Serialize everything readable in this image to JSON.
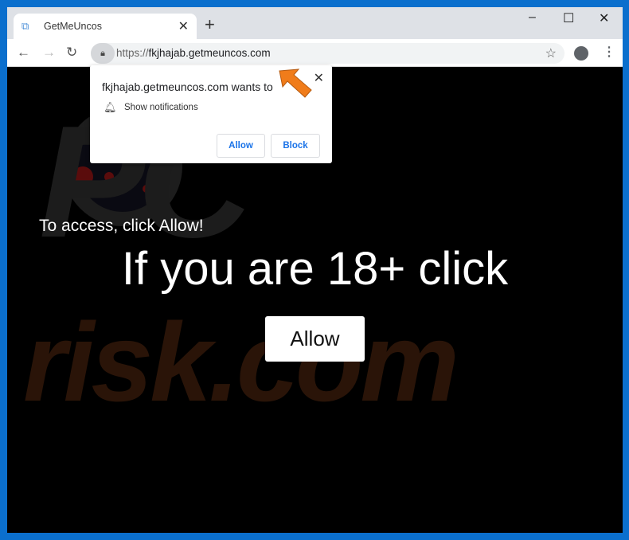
{
  "browser": {
    "tab": {
      "title": "GetMeUncos",
      "favicon": "site-icon"
    },
    "url": {
      "scheme": "https://",
      "host": "fkjhajab.getmeuncos.com"
    },
    "window_controls": {
      "minimize": "–",
      "maximize": "☐",
      "close": "✕"
    }
  },
  "popup": {
    "heading": "fkjhajab.getmeuncos.com wants to",
    "permission": "Show notifications",
    "allow_label": "Allow",
    "block_label": "Block",
    "close": "✕"
  },
  "page": {
    "instruction": "To access, click Allow!",
    "headline": "If you are 18+ click",
    "allow_button": "Allow"
  },
  "watermark": {
    "text_top": "PC",
    "text_bottom": "risk.com"
  },
  "colors": {
    "window_border": "#0b6fcd",
    "accent": "#1a73e8",
    "arrow": "#f07c1a"
  }
}
